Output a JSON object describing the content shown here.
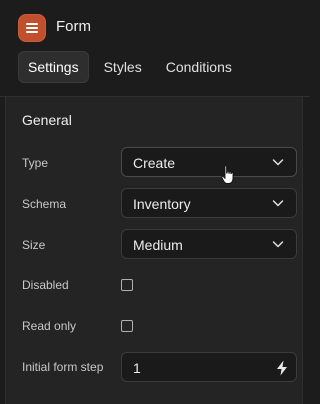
{
  "header": {
    "title": "Form",
    "app_icon": "hamburger-menu-icon",
    "accent_color": "#c2502d"
  },
  "tabs": [
    {
      "label": "Settings",
      "active": true
    },
    {
      "label": "Styles",
      "active": false
    },
    {
      "label": "Conditions",
      "active": false
    }
  ],
  "general": {
    "title": "General",
    "fields": {
      "type": {
        "label": "Type",
        "value": "Create"
      },
      "schema": {
        "label": "Schema",
        "value": "Inventory"
      },
      "size": {
        "label": "Size",
        "value": "Medium"
      },
      "disabled": {
        "label": "Disabled",
        "checked": false
      },
      "read_only": {
        "label": "Read only",
        "checked": false
      },
      "initial_step": {
        "label": "Initial form step",
        "value": "1",
        "icon": "lightning-bolt-icon"
      }
    }
  }
}
